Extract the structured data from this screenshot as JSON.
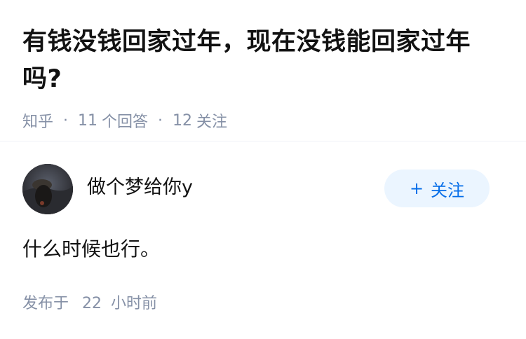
{
  "question": {
    "title": "有钱没钱回家过年，现在没钱能回家过年吗?",
    "source": "知乎",
    "answer_count": "11",
    "answer_label": "个回答",
    "follower_count": "12",
    "follower_label": "关注"
  },
  "author": {
    "name": "做个梦给你y",
    "follow_label": "关注",
    "follow_icon": "+"
  },
  "answer": {
    "content": "什么时候也行。",
    "time_prefix": "发布于",
    "time_value": "22",
    "time_unit": "小时前"
  },
  "colors": {
    "accent": "#056de8",
    "follow_bg": "#ebf5ff",
    "meta": "#8590a6",
    "text": "#121212"
  }
}
